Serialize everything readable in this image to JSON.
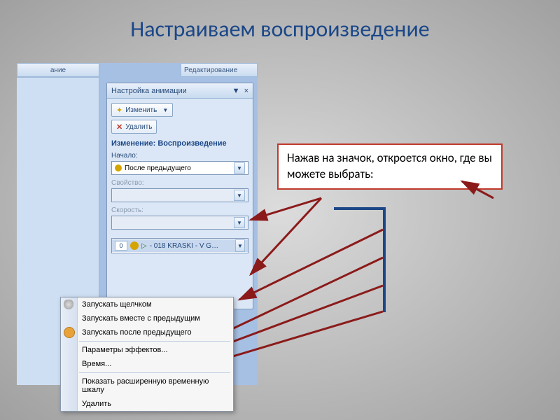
{
  "slide": {
    "title": "Настраиваем воспроизведение"
  },
  "ribbon": {
    "group1": "ание",
    "group2": "Редактирование"
  },
  "pane": {
    "title": "Настройка анимации",
    "close": "×",
    "pin": "▼",
    "change_btn": "Изменить",
    "remove_btn": "Удалить",
    "section": "Изменение: Воспроизведение",
    "start_label": "Начало:",
    "start_value": "После предыдущего",
    "property_label": "Свойство:",
    "speed_label": "Скорость:",
    "anim_item": {
      "num": "0",
      "text": "- 018 KRASKI - V G…"
    }
  },
  "menu": {
    "items": [
      "Запускать щелчком",
      "Запускать вместе с предыдущим",
      "Запускать после предыдущего",
      "Параметры эффектов...",
      "Время...",
      "Показать расширенную временную шкалу",
      "Удалить"
    ]
  },
  "callout": {
    "text": "Нажав на значок, откроется окно, где вы можете выбрать:"
  }
}
